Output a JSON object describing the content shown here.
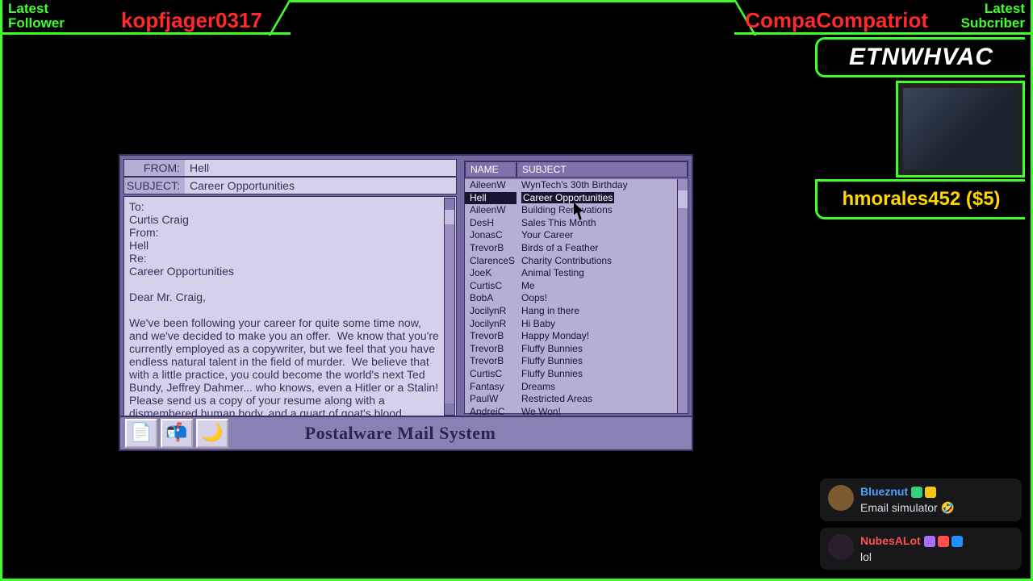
{
  "overlay": {
    "follower_label_l1": "Latest",
    "follower_label_l2": "Follower",
    "follower_name": "kopfjager0317",
    "subscriber_label_l1": "Latest",
    "subscriber_label_l2": "Subcriber",
    "subscriber_name": "CompaCompatriot",
    "logo_text": "ETNWHVAC",
    "donation_text": "hmorales452 ($5)"
  },
  "mail": {
    "from_label": "FROM:",
    "subject_label": "SUBJECT:",
    "from_value": "Hell",
    "subject_value": "Career Opportunities",
    "body": "To:\nCurtis Craig\nFrom:\nHell\nRe:\nCareer Opportunities\n\nDear Mr. Craig,\n\nWe've been following your career for quite some time now, and we've decided to make you an offer.  We know that you're currently employed as a copywriter, but we feel that you have endless natural talent in the field of murder.  We believe that with a little practice, you could become the world's next Ted Bundy, Jeffrey Dahmer... who knows, even a Hitler or a Stalin!  Please send us a copy of your resume along with a dismembered human body, and a quart of goat's blood.",
    "bottom_title": "Postalware Mail System",
    "list_header_name": "NAME",
    "list_header_subject": "SUBJECT"
  },
  "inbox": [
    {
      "name": "AileenW",
      "subject": "WynTech's 30th Birthday"
    },
    {
      "name": "Hell",
      "subject": "Career Opportunities"
    },
    {
      "name": "AileenW",
      "subject": "Building Renovations"
    },
    {
      "name": "DesH",
      "subject": "Sales This Month"
    },
    {
      "name": "JonasC",
      "subject": "Your Career"
    },
    {
      "name": "TrevorB",
      "subject": "Birds of a Feather"
    },
    {
      "name": "ClarenceS",
      "subject": "Charity Contributions"
    },
    {
      "name": "JoeK",
      "subject": "Animal Testing"
    },
    {
      "name": "CurtisC",
      "subject": "Me"
    },
    {
      "name": "BobA",
      "subject": "Oops!"
    },
    {
      "name": "JocilynR",
      "subject": "Hang in there"
    },
    {
      "name": "JocilynR",
      "subject": "Hi Baby"
    },
    {
      "name": "TrevorB",
      "subject": "Happy Monday!"
    },
    {
      "name": "TrevorB",
      "subject": "Fluffy Bunnies"
    },
    {
      "name": "TrevorB",
      "subject": "Fluffy Bunnies"
    },
    {
      "name": "CurtisC",
      "subject": "Fluffy Bunnies"
    },
    {
      "name": "Fantasy",
      "subject": "Dreams"
    },
    {
      "name": "PaulW",
      "subject": "Restricted Areas"
    },
    {
      "name": "AndreiC",
      "subject": "We Won!"
    }
  ],
  "inbox_selected_index": 1,
  "chat": [
    {
      "user": "Blueznut",
      "user_color": "#4aa3ff",
      "avatar_color": "#7a5a2e",
      "badges": [
        "#33d17a",
        "#f5c518"
      ],
      "message": "Email simulator 🤣"
    },
    {
      "user": "NubesALot",
      "user_color": "#ff4f4f",
      "avatar_color": "#2a1e2e",
      "badges": [
        "#a970ff",
        "#ff4f4f",
        "#1e90ff"
      ],
      "message": "lol"
    }
  ]
}
